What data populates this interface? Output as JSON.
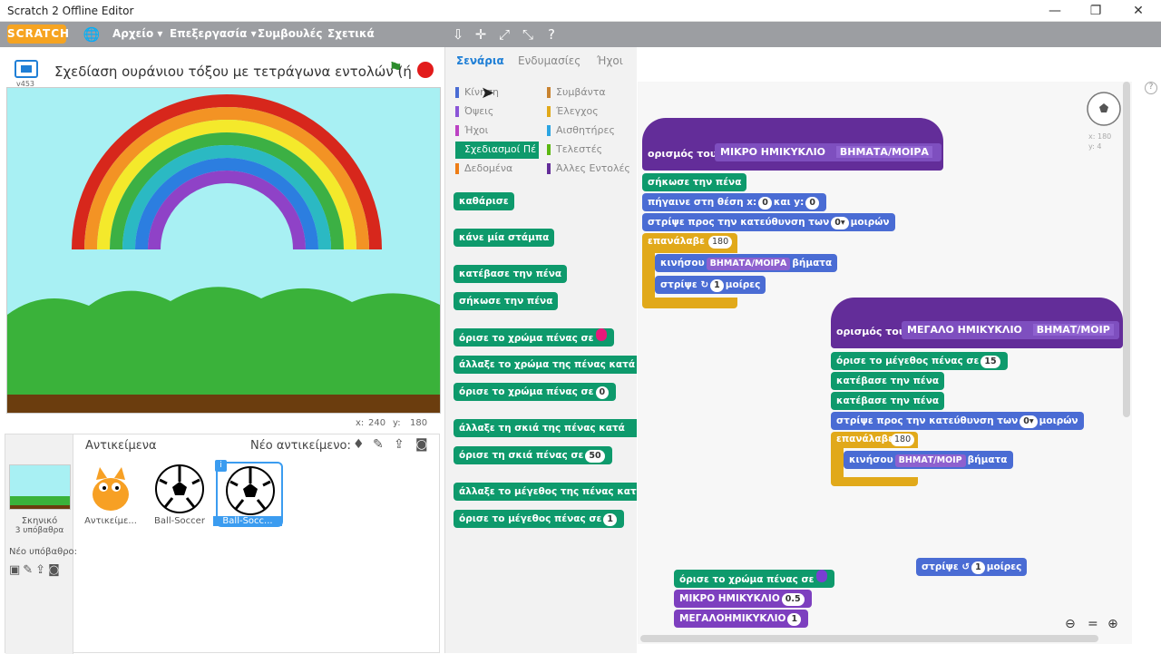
{
  "window": {
    "title": "Scratch 2 Offline Editor"
  },
  "menu": {
    "logo": "SCRATCH",
    "items": [
      "Αρχείο ▾",
      "Επεξεργασία ▾",
      "Συμβουλές",
      "Σχετικά"
    ]
  },
  "stage": {
    "project_title": "Σχεδίαση ουράνιου τόξου με τετράγωνα εντολών (ή",
    "version": "v453",
    "x_label": "x:",
    "x_val": "240",
    "y_label": "y:",
    "y_val": "180"
  },
  "sprites": {
    "header": "Αντικείμενα",
    "new_sprite": "Νέο αντικείμενο:",
    "stage_name": "Σκηνικό",
    "stage_backdrops": "3 υπόβαθρα",
    "new_backdrop": "Νέο υπόβαθρο:",
    "list": [
      "Αντικείμε...",
      "Ball-Soccer",
      "Ball-Socc..."
    ]
  },
  "tabs": {
    "scripts": "Σενάρια",
    "costumes": "Ενδυμασίες",
    "sounds": "Ήχοι"
  },
  "categories": {
    "left": [
      "Κίνηση",
      "Όψεις",
      "Ήχοι",
      "Σχεδιασμοί Πέ",
      "Δεδομένα"
    ],
    "right": [
      "Συμβάντα",
      "Έλεγχος",
      "Αισθητήρες",
      "Τελεστές",
      "Άλλες Εντολές"
    ],
    "colors": {
      "motion": "#4a6cd4",
      "looks": "#8a55d7",
      "sound": "#bb42c3",
      "pen": "#0e9a6c",
      "data": "#ee7d16",
      "events": "#c88330",
      "control": "#e1a91a",
      "sensing": "#2ca5e2",
      "operators": "#5cb712",
      "more": "#632d99"
    }
  },
  "palette": {
    "clear": "καθάρισε",
    "stamp": "κάνε μία στάμπα",
    "pen_down": "κατέβασε την πένα",
    "pen_up": "σήκωσε την πένα",
    "set_color": "όρισε το χρώμα πένας σε",
    "change_color": "άλλαξε το χρώμα της πένας κατά",
    "set_color_num": "όρισε το χρώμα πένας σε",
    "set_color_num_val": "0",
    "change_shade": "άλλαξε τη σκιά της πένας κατά",
    "set_shade": "όρισε τη σκιά πένας σε",
    "set_shade_val": "50",
    "change_size": "άλλαξε το μέγεθος της πένας κατά",
    "set_size": "όρισε το μέγεθος πένας σε",
    "set_size_val": "1"
  },
  "script1": {
    "define": "ορισμός του",
    "name": "ΜΙΚΡΟ ΗΜΙΚΥΚΛΙΟ",
    "param": "ΒΗΜΑΤΑ/ΜΟΙΡΑ",
    "pen_up": "σήκωσε την πένα",
    "goto": "πήγαινε στη θέση x:",
    "goto_x": "0",
    "goto_y_label": "και y:",
    "goto_y": "0",
    "point": "στρίψε προς την κατεύθυνση των",
    "point_val": "0▾",
    "point_unit": "μοιρών",
    "repeat": "επανάλαβε",
    "repeat_val": "180",
    "move": "κινήσου",
    "move_param": "ΒΗΜΑΤΑ/ΜΟΙΡΑ",
    "move_unit": "βήματα",
    "turn": "στρίψε ↻",
    "turn_val": "1",
    "turn_unit": "μοίρες"
  },
  "script2": {
    "define": "ορισμός του",
    "name": "ΜΕΓΑΛΟ ΗΜΙΚΥΚΛΙΟ",
    "param": "ΒΗΜΑΤ/ΜΟΙΡ",
    "set_size": "όρισε το μέγεθος πένας σε",
    "set_size_val": "15",
    "pen_down1": "κατέβασε την πένα",
    "pen_down2": "κατέβασε την πένα",
    "point": "στρίψε προς την κατεύθυνση των",
    "point_val": "0▾",
    "point_unit": "μοιρών",
    "repeat": "επανάλαβε",
    "repeat_val": "180",
    "move": "κινήσου",
    "move_param": "ΒΗΜΑΤ/ΜΟΙΡ",
    "move_unit": "βήματα"
  },
  "loose": {
    "turn": "στρίψε ↺",
    "turn_val": "1",
    "turn_unit": "μοίρες",
    "set_color": "όρισε το χρώμα πένας σε",
    "small": "ΜΙΚΡΟ ΗΜΙΚΥΚΛΙΟ",
    "small_val": "0.5",
    "big": "ΜΕΓΑΛΟΗΜΙΚΥΚΛΙΟ",
    "big_val": "1"
  },
  "sprite_info": {
    "x": "x: 180",
    "y": "y: 4"
  }
}
